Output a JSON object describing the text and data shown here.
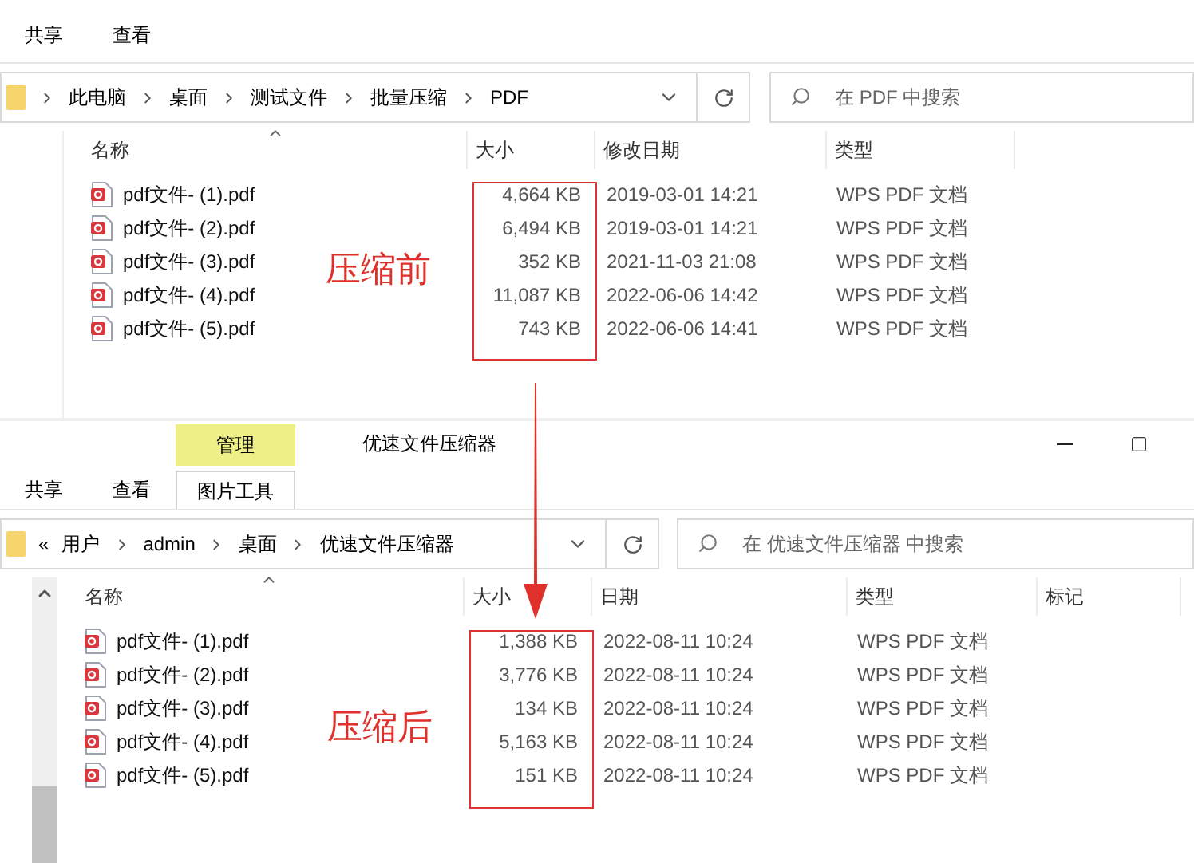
{
  "windows": [
    {
      "kind": "plain",
      "ribbon_tabs": [
        {
          "label": "共享",
          "selected": false
        },
        {
          "label": "查看",
          "selected": false
        }
      ],
      "breadcrumbs": [
        "此电脑",
        "桌面",
        "测试文件",
        "批量压缩",
        "PDF"
      ],
      "search_placeholder": "在 PDF 中搜索",
      "columns": [
        "名称",
        "大小",
        "修改日期",
        "类型"
      ],
      "files": [
        {
          "name": "pdf文件- (1).pdf",
          "size": "4,664 KB",
          "date": "2019-03-01 14:21",
          "type": "WPS PDF 文档"
        },
        {
          "name": "pdf文件- (2).pdf",
          "size": "6,494 KB",
          "date": "2019-03-01 14:21",
          "type": "WPS PDF 文档"
        },
        {
          "name": "pdf文件- (3).pdf",
          "size": "352 KB",
          "date": "2021-11-03 21:08",
          "type": "WPS PDF 文档"
        },
        {
          "name": "pdf文件- (4).pdf",
          "size": "11,087 KB",
          "date": "2022-06-06 14:42",
          "type": "WPS PDF 文档"
        },
        {
          "name": "pdf文件- (5).pdf",
          "size": "743 KB",
          "date": "2022-06-06 14:41",
          "type": "WPS PDF 文档"
        }
      ],
      "annotation": "压缩前"
    },
    {
      "kind": "titled",
      "context_tab": "管理",
      "title": "优速文件压缩器",
      "ribbon_tabs": [
        {
          "label": "共享",
          "selected": false
        },
        {
          "label": "查看",
          "selected": false
        },
        {
          "label": "图片工具",
          "selected": true
        }
      ],
      "overflow": "«",
      "breadcrumbs": [
        "用户",
        "admin",
        "桌面",
        "优速文件压缩器"
      ],
      "search_placeholder": "在 优速文件压缩器 中搜索",
      "columns": [
        "名称",
        "大小",
        "日期",
        "类型",
        "标记"
      ],
      "files": [
        {
          "name": "pdf文件- (1).pdf",
          "size": "1,388 KB",
          "date": "2022-08-11 10:24",
          "type": "WPS PDF 文档"
        },
        {
          "name": "pdf文件- (2).pdf",
          "size": "3,776 KB",
          "date": "2022-08-11 10:24",
          "type": "WPS PDF 文档"
        },
        {
          "name": "pdf文件- (3).pdf",
          "size": "134 KB",
          "date": "2022-08-11 10:24",
          "type": "WPS PDF 文档"
        },
        {
          "name": "pdf文件- (4).pdf",
          "size": "5,163 KB",
          "date": "2022-08-11 10:24",
          "type": "WPS PDF 文档"
        },
        {
          "name": "pdf文件- (5).pdf",
          "size": "151 KB",
          "date": "2022-08-11 10:24",
          "type": "WPS PDF 文档"
        }
      ],
      "annotation": "压缩后"
    }
  ]
}
